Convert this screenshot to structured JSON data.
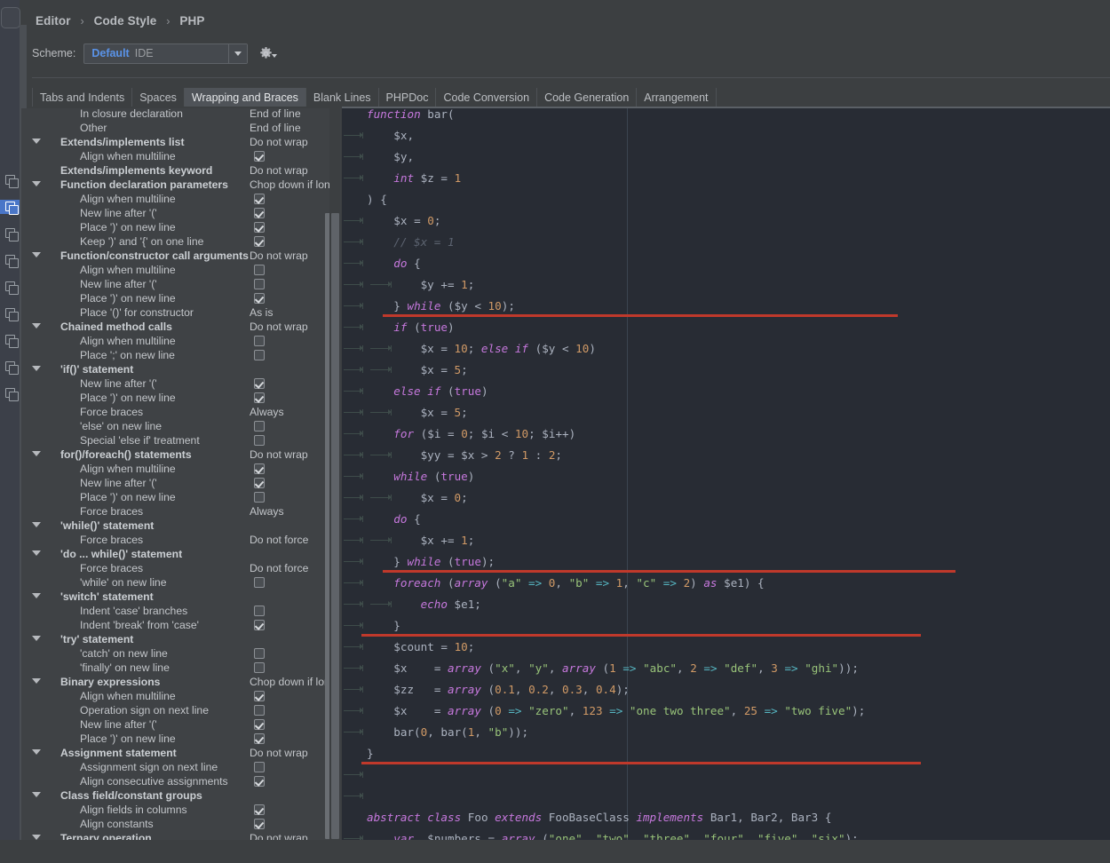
{
  "window": {
    "breadcrumb": [
      "Editor",
      "Code Style",
      "PHP"
    ],
    "breadcrumb_separator": "›"
  },
  "scheme": {
    "label": "Scheme:",
    "value": "Default",
    "value_suffix": "IDE",
    "dropdown_icon": "chevron-down-icon",
    "gear_icon": "gear-icon"
  },
  "tabs": [
    {
      "label": "Tabs and Indents",
      "active": false
    },
    {
      "label": "Spaces",
      "active": false
    },
    {
      "label": "Wrapping and Braces",
      "active": true
    },
    {
      "label": "Blank Lines",
      "active": false
    },
    {
      "label": "PHPDoc",
      "active": false
    },
    {
      "label": "Code Conversion",
      "active": false
    },
    {
      "label": "Code Generation",
      "active": false
    },
    {
      "label": "Arrangement",
      "active": false
    }
  ],
  "settings_tree": [
    {
      "level": 1,
      "label": "In closure declaration",
      "value": "End of line",
      "kind": "text"
    },
    {
      "level": 1,
      "label": "Other",
      "value": "End of line",
      "kind": "text"
    },
    {
      "level": 0,
      "label": "Extends/implements list",
      "value": "Do not wrap",
      "kind": "text",
      "expanded": true
    },
    {
      "level": 1,
      "label": "Align when multiline",
      "value": true,
      "kind": "checkbox"
    },
    {
      "level": 0,
      "label": "Extends/implements keyword",
      "value": "Do not wrap",
      "kind": "text",
      "expanded": false
    },
    {
      "level": 0,
      "label": "Function declaration parameters",
      "value": "Chop down if long",
      "kind": "text",
      "expanded": true
    },
    {
      "level": 1,
      "label": "Align when multiline",
      "value": true,
      "kind": "checkbox"
    },
    {
      "level": 1,
      "label": "New line after '('",
      "value": true,
      "kind": "checkbox"
    },
    {
      "level": 1,
      "label": "Place ')' on new line",
      "value": true,
      "kind": "checkbox"
    },
    {
      "level": 1,
      "label": "Keep ')' and '{' on one line",
      "value": true,
      "kind": "checkbox"
    },
    {
      "level": 0,
      "label": "Function/constructor call arguments",
      "value": "Do not wrap",
      "kind": "text",
      "expanded": true
    },
    {
      "level": 1,
      "label": "Align when multiline",
      "value": false,
      "kind": "checkbox"
    },
    {
      "level": 1,
      "label": "New line after '('",
      "value": false,
      "kind": "checkbox"
    },
    {
      "level": 1,
      "label": "Place ')' on new line",
      "value": true,
      "kind": "checkbox"
    },
    {
      "level": 1,
      "label": "Place '()' for constructor",
      "value": "As is",
      "kind": "text"
    },
    {
      "level": 0,
      "label": "Chained method calls",
      "value": "Do not wrap",
      "kind": "text",
      "expanded": true
    },
    {
      "level": 1,
      "label": "Align when multiline",
      "value": false,
      "kind": "checkbox"
    },
    {
      "level": 1,
      "label": "Place ';' on new line",
      "value": false,
      "kind": "checkbox"
    },
    {
      "level": 0,
      "label": "'if()' statement",
      "value": "",
      "kind": "none",
      "expanded": true
    },
    {
      "level": 1,
      "label": "New line after '('",
      "value": true,
      "kind": "checkbox"
    },
    {
      "level": 1,
      "label": "Place ')' on new line",
      "value": true,
      "kind": "checkbox"
    },
    {
      "level": 1,
      "label": "Force braces",
      "value": "Always",
      "kind": "text"
    },
    {
      "level": 1,
      "label": "'else' on new line",
      "value": false,
      "kind": "checkbox"
    },
    {
      "level": 1,
      "label": "Special 'else if' treatment",
      "value": false,
      "kind": "checkbox"
    },
    {
      "level": 0,
      "label": "for()/foreach() statements",
      "value": "Do not wrap",
      "kind": "text",
      "expanded": true
    },
    {
      "level": 1,
      "label": "Align when multiline",
      "value": true,
      "kind": "checkbox"
    },
    {
      "level": 1,
      "label": "New line after '('",
      "value": true,
      "kind": "checkbox"
    },
    {
      "level": 1,
      "label": "Place ')' on new line",
      "value": false,
      "kind": "checkbox"
    },
    {
      "level": 1,
      "label": "Force braces",
      "value": "Always",
      "kind": "text"
    },
    {
      "level": 0,
      "label": "'while()' statement",
      "value": "",
      "kind": "none",
      "expanded": true
    },
    {
      "level": 1,
      "label": "Force braces",
      "value": "Do not force",
      "kind": "text"
    },
    {
      "level": 0,
      "label": "'do ... while()' statement",
      "value": "",
      "kind": "none",
      "expanded": true
    },
    {
      "level": 1,
      "label": "Force braces",
      "value": "Do not force",
      "kind": "text"
    },
    {
      "level": 1,
      "label": "'while' on new line",
      "value": false,
      "kind": "checkbox"
    },
    {
      "level": 0,
      "label": "'switch' statement",
      "value": "",
      "kind": "none",
      "expanded": true
    },
    {
      "level": 1,
      "label": "Indent 'case' branches",
      "value": false,
      "kind": "checkbox"
    },
    {
      "level": 1,
      "label": "Indent 'break' from 'case'",
      "value": true,
      "kind": "checkbox"
    },
    {
      "level": 0,
      "label": "'try' statement",
      "value": "",
      "kind": "none",
      "expanded": true
    },
    {
      "level": 1,
      "label": "'catch' on new line",
      "value": false,
      "kind": "checkbox"
    },
    {
      "level": 1,
      "label": "'finally' on new line",
      "value": false,
      "kind": "checkbox"
    },
    {
      "level": 0,
      "label": "Binary expressions",
      "value": "Chop down if long",
      "kind": "text",
      "expanded": true
    },
    {
      "level": 1,
      "label": "Align when multiline",
      "value": true,
      "kind": "checkbox"
    },
    {
      "level": 1,
      "label": "Operation sign on next line",
      "value": false,
      "kind": "checkbox"
    },
    {
      "level": 1,
      "label": "New line after '('",
      "value": true,
      "kind": "checkbox"
    },
    {
      "level": 1,
      "label": "Place ')' on new line",
      "value": true,
      "kind": "checkbox"
    },
    {
      "level": 0,
      "label": "Assignment statement",
      "value": "Do not wrap",
      "kind": "text",
      "expanded": true
    },
    {
      "level": 1,
      "label": "Assignment sign on next line",
      "value": false,
      "kind": "checkbox"
    },
    {
      "level": 1,
      "label": "Align consecutive assignments",
      "value": true,
      "kind": "checkbox"
    },
    {
      "level": 0,
      "label": "Class field/constant groups",
      "value": "",
      "kind": "none",
      "expanded": true
    },
    {
      "level": 1,
      "label": "Align fields in columns",
      "value": true,
      "kind": "checkbox"
    },
    {
      "level": 1,
      "label": "Align constants",
      "value": true,
      "kind": "checkbox"
    },
    {
      "level": 0,
      "label": "Ternary operation",
      "value": "Do not wrap",
      "kind": "text",
      "expanded": true
    }
  ],
  "code_preview": {
    "language": "PHP",
    "lines": [
      "function bar(",
      "    $x,",
      "    $y,",
      "    int $z = 1",
      ") {",
      "    $x = 0;",
      "    // $x = 1",
      "    do {",
      "        $y += 1;",
      "    } while ($y < 10);",
      "    if (true)",
      "        $x = 10; else if ($y < 10)",
      "        $x = 5;",
      "    else if (true)",
      "        $x = 5;",
      "    for ($i = 0; $i < 10; $i++)",
      "        $yy = $x > 2 ? 1 : 2;",
      "    while (true)",
      "        $x = 0;",
      "    do {",
      "        $x += 1;",
      "    } while (true);",
      "    foreach (array (\"a\" => 0, \"b\" => 1, \"c\" => 2) as $e1) {",
      "        echo $e1;",
      "    }",
      "    $count = 10;",
      "    $x    = array (\"x\", \"y\", array (1 => \"abc\", 2 => \"def\", 3 => \"ghi\"));",
      "    $zz   = array (0.1, 0.2, 0.3, 0.4);",
      "    $x    = array (0 => \"zero\", 123 => \"one two three\", 25 => \"two five\");",
      "    bar(0, bar(1, \"b\"));",
      "}",
      "",
      "",
      "abstract class Foo extends FooBaseClass implements Bar1, Bar2, Bar3 {",
      "    var  $numbers = array (\"one\", \"two\", \"three\", \"four\", \"five\", \"six\");"
    ],
    "highlight_marker_color": "#c0392b",
    "highlighted_after_lines": [
      "} while ($y < 10);",
      "} while (true);",
      "}"
    ]
  },
  "colors": {
    "editor_background": "#282c34",
    "panel_background": "#3f4245",
    "chrome_background": "#3c3f41",
    "accent_blue": "#5a93e8",
    "selection_blue": "#4a76c8",
    "keyword": "#c678dd",
    "string": "#98c379",
    "number": "#d19a66",
    "comment": "#5c6370",
    "default_text": "#abb2bf",
    "change_marker_red": "#c0392b"
  },
  "gutter": {
    "icon_name": "copy-settings-icon",
    "selected_index": 1,
    "count": 9
  }
}
